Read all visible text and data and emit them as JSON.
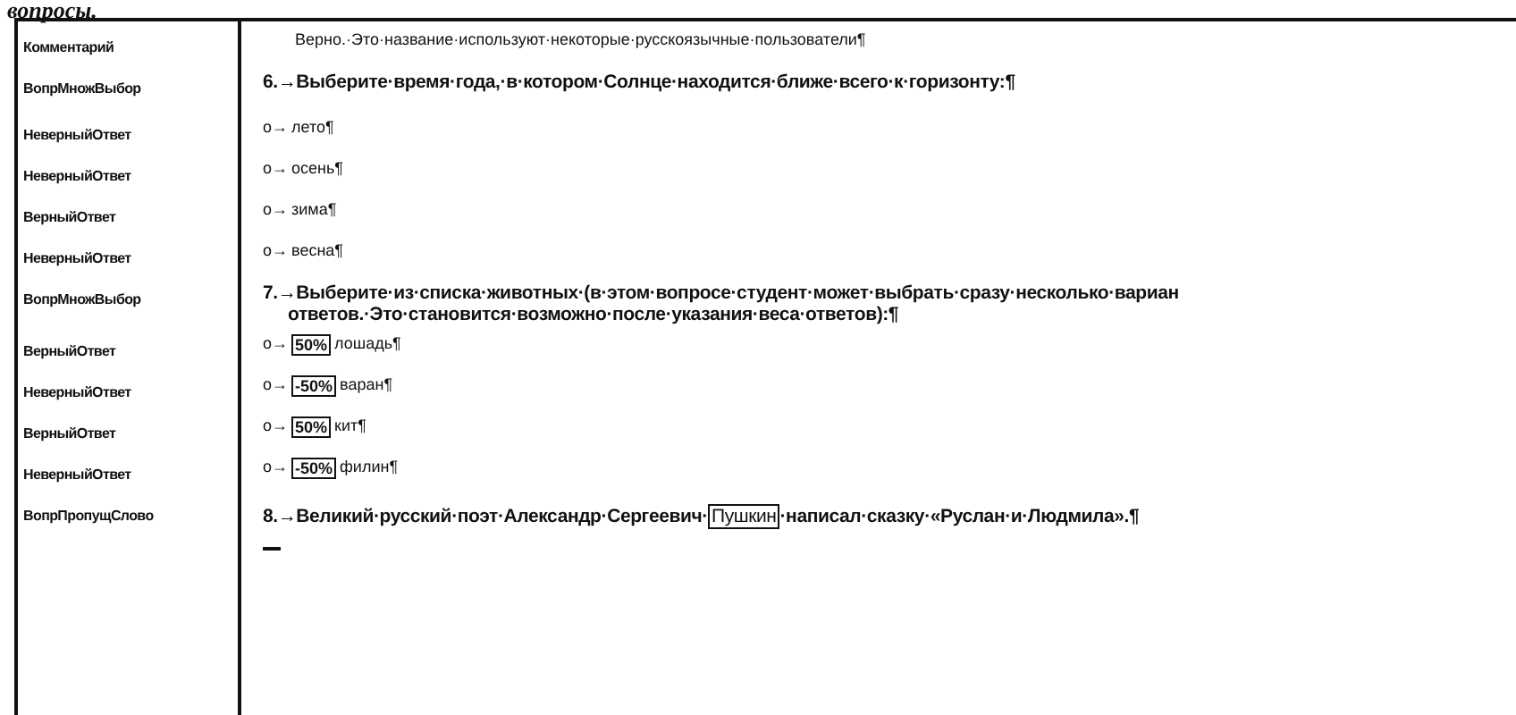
{
  "caption": "вопросы.",
  "rows": [
    {
      "style": "Комментарий",
      "kind": "comment",
      "text": "Верно.·Это·название·используют·некоторые·русскоязычные·пользователи¶"
    },
    {
      "style": "ВопрМножВыбор",
      "kind": "question",
      "lines": [
        "6.→Выберите·время·года,·в·котором·Солнце·находится·ближе·всего·к·горизонту:¶"
      ]
    },
    {
      "style": "НеверныйОтвет",
      "kind": "option",
      "bullet": "о→",
      "text": "лето¶"
    },
    {
      "style": "НеверныйОтвет",
      "kind": "option",
      "bullet": "о→",
      "text": "осень¶"
    },
    {
      "style": "ВерныйОтвет",
      "kind": "option",
      "bullet": "о→",
      "text": "зима¶"
    },
    {
      "style": "НеверныйОтвет",
      "kind": "option",
      "bullet": "о→",
      "text": "весна¶"
    },
    {
      "style": "ВопрМножВыбор",
      "kind": "question",
      "lines": [
        "7.→Выберите·из·списка·животных·(в·этом·вопросе·студент·может·выбрать·сразу·несколько·вариан",
        "ответов.·Это·становится·возможно·после·указания·веса·ответов):¶"
      ]
    },
    {
      "style": "ВерныйОтвет",
      "kind": "weighted",
      "bullet": "о→",
      "weight": "50%",
      "text": "лошадь¶"
    },
    {
      "style": "НеверныйОтвет",
      "kind": "weighted",
      "bullet": "о→",
      "weight": "-50%",
      "text": "варан¶"
    },
    {
      "style": "ВерныйОтвет",
      "kind": "weighted",
      "bullet": "о→",
      "weight": "50%",
      "text": "кит¶"
    },
    {
      "style": "НеверныйОтвет",
      "kind": "weighted",
      "bullet": "о→",
      "weight": "-50%",
      "text": "филин¶"
    },
    {
      "style": "ВопрПропущСлово",
      "kind": "gap",
      "before": "8.→Великий·русский·поэт·Александр·Сергеевич·",
      "field": "Пушкин",
      "after": "·написал·сказку·«Руслан·и·Людмила».¶"
    }
  ]
}
